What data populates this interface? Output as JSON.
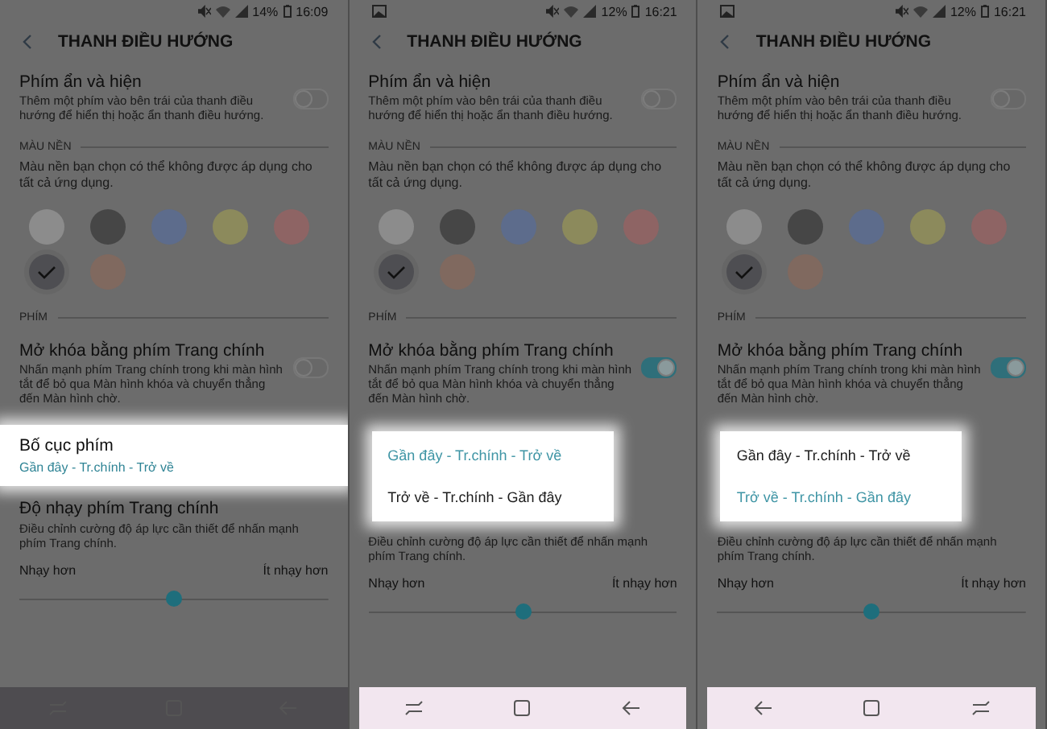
{
  "panels": [
    {
      "status_bar": {
        "battery": "14%",
        "time": "16:09"
      },
      "header": {
        "title": "THANH ĐIỀU HƯỚNG"
      },
      "settings": [
        {
          "kind": "switch",
          "title": "Phím ẩn và hiện",
          "description": "Thêm một phím vào bên trái của thanh điều hướng để hiển thị hoặc ẩn thanh điều hướng.",
          "on": false
        },
        {
          "kind": "section",
          "label": "MÀU NỀN"
        },
        {
          "kind": "note",
          "text": "Màu nền bạn chọn có thể không được áp dụng cho tất cả ứng dụng."
        },
        {
          "kind": "colors",
          "swatches": [
            {
              "color": "#8c8c8c",
              "selected": false
            },
            {
              "color": "#464646",
              "selected": false
            },
            {
              "color": "#5d6c8c",
              "selected": false
            },
            {
              "color": "#8c8a5c",
              "selected": false
            },
            {
              "color": "#8e6464",
              "selected": false
            },
            {
              "color": "#4e4e52",
              "selected": true
            },
            {
              "color": "#80695f",
              "selected": false
            }
          ]
        },
        {
          "kind": "section",
          "label": "PHÍM"
        },
        {
          "kind": "switch",
          "title": "Mở khóa bằng phím Trang chính",
          "description": "Nhấn mạnh phím Trang chính trong khi màn hình tắt để bỏ qua Màn hình khóa và chuyển thẳng đến Màn hình chờ.",
          "on": false
        },
        {
          "kind": "value",
          "title": "Bố cục phím",
          "value": "Gần đây - Tr.chính - Trở về",
          "highlighted": true
        },
        {
          "kind": "slider",
          "title": "Độ nhạy phím Trang chính",
          "description": "Điều chỉnh cường độ áp lực cần thiết để nhấn mạnh phím Trang chính.",
          "min_label": "Nhạy hơn",
          "max_label": "Ít nhạy hơn",
          "level": 0.5
        }
      ],
      "nav_bar": {
        "highlighted": false,
        "buttons": [
          {
            "kind": "recent"
          },
          {
            "kind": "home"
          },
          {
            "kind": "back"
          }
        ]
      }
    },
    {
      "status_bar": {
        "gallery_notification": true,
        "battery": "12%",
        "time": "16:21"
      },
      "header": {
        "title": "THANH ĐIỀU HƯỚNG"
      },
      "settings": [
        {
          "kind": "switch",
          "title": "Phím ẩn và hiện",
          "description": "Thêm một phím vào bên trái của thanh điều hướng để hiển thị hoặc ẩn thanh điều hướng.",
          "on": false
        },
        {
          "kind": "section",
          "label": "MÀU NỀN"
        },
        {
          "kind": "note",
          "text": "Màu nền bạn chọn có thể không được áp dụng cho tất cả ứng dụng."
        },
        {
          "kind": "colors",
          "swatches": [
            {
              "color": "#8c8c8c",
              "selected": false
            },
            {
              "color": "#464646",
              "selected": false
            },
            {
              "color": "#5d6c8c",
              "selected": false
            },
            {
              "color": "#8c8a5c",
              "selected": false
            },
            {
              "color": "#8e6464",
              "selected": false
            },
            {
              "color": "#4e4e52",
              "selected": true
            },
            {
              "color": "#80695f",
              "selected": false
            }
          ]
        },
        {
          "kind": "section",
          "label": "PHÍM"
        },
        {
          "kind": "switch",
          "title": "Mở khóa bằng phím Trang chính",
          "description": "Nhấn mạnh phím Trang chính trong khi màn hình tắt để bỏ qua Màn hình khóa và chuyển thẳng đến Màn hình chờ.",
          "on": true
        },
        {
          "kind": "menu",
          "options": [
            {
              "label": "Gần đây - Tr.chính - Trở về",
              "selected": true
            },
            {
              "label": "Trở về - Tr.chính - Gần đây",
              "selected": false
            }
          ]
        },
        {
          "kind": "slider",
          "description": "Điều chỉnh cường độ áp lực cần thiết để nhấn mạnh phím Trang chính.",
          "min_label": "Nhạy hơn",
          "max_label": "Ít nhạy hơn",
          "level": 0.5
        }
      ],
      "nav_bar": {
        "highlighted": true,
        "buttons": [
          {
            "kind": "recent"
          },
          {
            "kind": "home"
          },
          {
            "kind": "back"
          }
        ]
      }
    },
    {
      "status_bar": {
        "gallery_notification": true,
        "battery": "12%",
        "time": "16:21"
      },
      "header": {
        "title": "THANH ĐIỀU HƯỚNG"
      },
      "settings": [
        {
          "kind": "switch",
          "title": "Phím ẩn và hiện",
          "description": "Thêm một phím vào bên trái của thanh điều hướng để hiển thị hoặc ẩn thanh điều hướng.",
          "on": false
        },
        {
          "kind": "section",
          "label": "MÀU NỀN"
        },
        {
          "kind": "note",
          "text": "Màu nền bạn chọn có thể không được áp dụng cho tất cả ứng dụng."
        },
        {
          "kind": "colors",
          "swatches": [
            {
              "color": "#8c8c8c",
              "selected": false
            },
            {
              "color": "#464646",
              "selected": false
            },
            {
              "color": "#5d6c8c",
              "selected": false
            },
            {
              "color": "#8c8a5c",
              "selected": false
            },
            {
              "color": "#8e6464",
              "selected": false
            },
            {
              "color": "#4e4e52",
              "selected": true
            },
            {
              "color": "#80695f",
              "selected": false
            }
          ]
        },
        {
          "kind": "section",
          "label": "PHÍM"
        },
        {
          "kind": "switch",
          "title": "Mở khóa bằng phím Trang chính",
          "description": "Nhấn mạnh phím Trang chính trong khi màn hình tắt để bỏ qua Màn hình khóa và chuyển thẳng đến Màn hình chờ.",
          "on": true
        },
        {
          "kind": "menu",
          "options": [
            {
              "label": "Gần đây - Tr.chính - Trở về",
              "selected": false
            },
            {
              "label": "Trở về - Tr.chính - Gần đây",
              "selected": true
            }
          ]
        },
        {
          "kind": "slider",
          "description": "Điều chỉnh cường độ áp lực cần thiết để nhấn mạnh phím Trang chính.",
          "min_label": "Nhạy hơn",
          "max_label": "Ít nhạy hơn",
          "level": 0.5
        }
      ],
      "nav_bar": {
        "highlighted": true,
        "buttons": [
          {
            "kind": "back"
          },
          {
            "kind": "home"
          },
          {
            "kind": "recent"
          }
        ]
      }
    }
  ]
}
